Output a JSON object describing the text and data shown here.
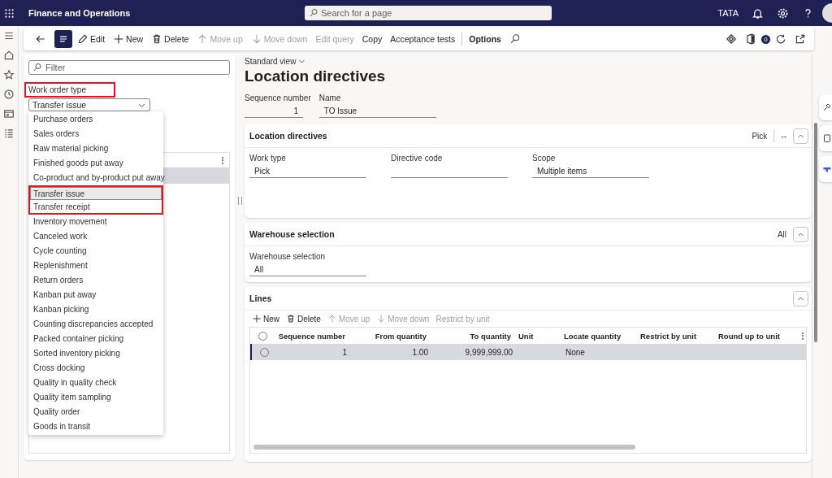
{
  "app_bar": {
    "title": "Finance and Operations",
    "search_placeholder": "Search for a page",
    "company": "TATA"
  },
  "toolbar": {
    "action_pane_toggle": {
      "on": true
    },
    "actions": [
      {
        "label": "Edit",
        "kind": "edit",
        "disabled": false
      },
      {
        "label": "New",
        "kind": "new",
        "disabled": false
      },
      {
        "label": "Delete",
        "kind": "delete",
        "disabled": false
      },
      {
        "label": "Move up",
        "kind": "up",
        "disabled": true
      },
      {
        "label": "Move down",
        "kind": "down",
        "disabled": true
      },
      {
        "label": "Edit query",
        "kind": "text",
        "disabled": true
      },
      {
        "label": "Copy",
        "kind": "text",
        "disabled": false
      },
      {
        "label": "Acceptance tests",
        "kind": "text",
        "disabled": false
      },
      {
        "label": "Options",
        "kind": "tab",
        "disabled": false
      }
    ],
    "badge": "0"
  },
  "left_panel": {
    "filter_placeholder": "Filter",
    "field_label": "Work order type",
    "label_annotated": true,
    "value": "Transfer issue",
    "options": [
      {
        "label": "Purchase orders",
        "selected": false,
        "annotated": false
      },
      {
        "label": "Sales orders",
        "selected": false,
        "annotated": false
      },
      {
        "label": "Raw material picking",
        "selected": false,
        "annotated": false
      },
      {
        "label": "Finished goods put away",
        "selected": false,
        "annotated": false
      },
      {
        "label": "Co-product and by-product put away",
        "selected": false,
        "annotated": false
      },
      {
        "label": "Transfer issue",
        "selected": true,
        "annotated": true
      },
      {
        "label": "Transfer receipt",
        "selected": false,
        "annotated": true
      },
      {
        "label": "Inventory movement",
        "selected": false,
        "annotated": false
      },
      {
        "label": "Canceled work",
        "selected": false,
        "annotated": false
      },
      {
        "label": "Cycle counting",
        "selected": false,
        "annotated": false
      },
      {
        "label": "Replenishment",
        "selected": false,
        "annotated": false
      },
      {
        "label": "Return orders",
        "selected": false,
        "annotated": false
      },
      {
        "label": "Kanban put away",
        "selected": false,
        "annotated": false
      },
      {
        "label": "Kanban picking",
        "selected": false,
        "annotated": false
      },
      {
        "label": "Counting discrepancies accepted",
        "selected": false,
        "annotated": false
      },
      {
        "label": "Packed container picking",
        "selected": false,
        "annotated": false
      },
      {
        "label": "Sorted inventory picking",
        "selected": false,
        "annotated": false
      },
      {
        "label": "Cross docking",
        "selected": false,
        "annotated": false
      },
      {
        "label": "Quality in quality check",
        "selected": false,
        "annotated": false
      },
      {
        "label": "Quality item sampling",
        "selected": false,
        "annotated": false
      },
      {
        "label": "Quality order",
        "selected": false,
        "annotated": false
      },
      {
        "label": "Goods in transit",
        "selected": false,
        "annotated": false
      }
    ],
    "list_rows": [
      {
        "selected": true
      }
    ]
  },
  "main": {
    "view": "Standard view",
    "title": "Location directives",
    "header_fields": [
      {
        "label": "Sequence number",
        "value": "1",
        "kind": "number"
      },
      {
        "label": "Name",
        "value": "TO Issue",
        "kind": "text"
      }
    ],
    "sections": [
      {
        "title": "Location directives",
        "summary": [
          "Pick",
          "--"
        ],
        "expanded": true,
        "fields": [
          {
            "label": "Work type",
            "value": "Pick"
          },
          {
            "label": "Directive code"
          },
          {
            "label": "Scope",
            "value": "Multiple items"
          }
        ]
      },
      {
        "title": "Warehouse selection",
        "summary": [
          "All"
        ],
        "expanded": true,
        "fields": [
          {
            "label": "Warehouse selection",
            "value": "All"
          }
        ]
      },
      {
        "title": "Lines",
        "expanded": true,
        "actions": [
          {
            "label": "New",
            "kind": "new",
            "disabled": false
          },
          {
            "label": "Delete",
            "kind": "delete",
            "disabled": false
          },
          {
            "label": "Move up",
            "kind": "up",
            "disabled": true
          },
          {
            "label": "Move down",
            "kind": "down",
            "disabled": true
          },
          {
            "label": "Restrict by unit",
            "kind": "text",
            "disabled": true
          }
        ],
        "columns": [
          {
            "label": "Sequence number",
            "kind": "number"
          },
          {
            "label": "From quantity",
            "kind": "number"
          },
          {
            "label": "To quantity",
            "kind": "number"
          },
          {
            "label": "Unit",
            "kind": "text"
          },
          {
            "label": "Locate quantity",
            "kind": "text"
          },
          {
            "label": "Restrict by unit",
            "kind": "text"
          },
          {
            "label": "Round up to unit",
            "kind": "text"
          }
        ],
        "select_all": {
          "checked": false
        },
        "rows": [
          {
            "selected": true,
            "checked": false,
            "cells": [
              "1",
              "1.00",
              "9,999,999.00",
              null,
              "None",
              null,
              null
            ]
          }
        ]
      }
    ]
  }
}
